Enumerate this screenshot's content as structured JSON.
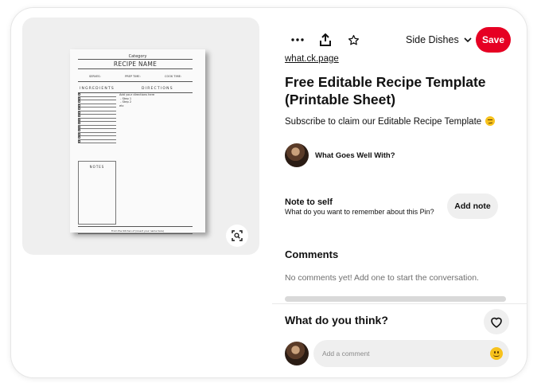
{
  "image": {
    "sheet": {
      "category": "Category",
      "recipe_name": "RECIPE NAME",
      "meta": [
        "SERVES:",
        "PREP TIME:",
        "COOK TIME:"
      ],
      "ingredients_heading": "INGREDIENTS",
      "directions_heading": "DIRECTIONS",
      "directions_text": "Add your directions here\n - Step 1\n - Step 2\netc",
      "notes_heading": "NOTES",
      "footer": "From the Kitchen of (insert your name here)"
    },
    "lens_icon": "visual-search-icon"
  },
  "toolbar": {
    "more_icon": "more-icon",
    "share_icon": "share-icon",
    "star_icon": "star-icon",
    "board": "Side Dishes",
    "board_icon": "chevron-down-icon",
    "save_label": "Save"
  },
  "pin": {
    "source": "what.ck.page",
    "title": "Free Editable Recipe Template (Printable Sheet)",
    "description": "Subscribe to claim our Editable Recipe Template",
    "description_emoji": "smirking-face-icon",
    "creator_name": "What Goes Well With?"
  },
  "note": {
    "title": "Note to self",
    "subtitle": "What do you want to remember about this Pin?",
    "button": "Add note"
  },
  "comments": {
    "heading": "Comments",
    "empty": "No comments yet! Add one to start the conversation."
  },
  "footer": {
    "prompt": "What do you think?",
    "reaction_icon": "heart-icon",
    "comment_placeholder": "Add a comment",
    "emoji_icon": "emoji-icon"
  },
  "colors": {
    "save_button": "#e60023",
    "panel_bg": "#efefef"
  }
}
